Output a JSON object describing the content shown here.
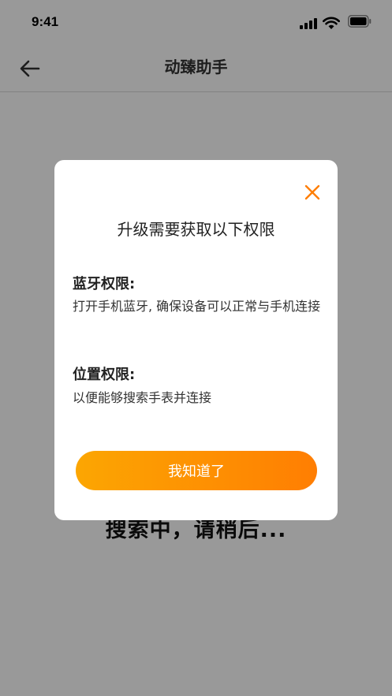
{
  "status_bar": {
    "time": "9:41"
  },
  "nav": {
    "title": "动臻助手",
    "back_icon": "arrow-left-icon"
  },
  "background": {
    "searching_text": "搜索中，请稍后..."
  },
  "dialog": {
    "title": "升级需要获取以下权限",
    "close_icon": "close-icon",
    "accent_color": "#ff7e02",
    "sections": [
      {
        "heading": "蓝牙权限:",
        "text": "打开手机蓝牙, 确保设备可以正常与手机连接"
      },
      {
        "heading": "位置权限:",
        "text": "以便能够搜索手表并连接"
      }
    ],
    "confirm_label": "我知道了",
    "button_gradient": [
      "#fca602",
      "#ff7e02"
    ]
  }
}
